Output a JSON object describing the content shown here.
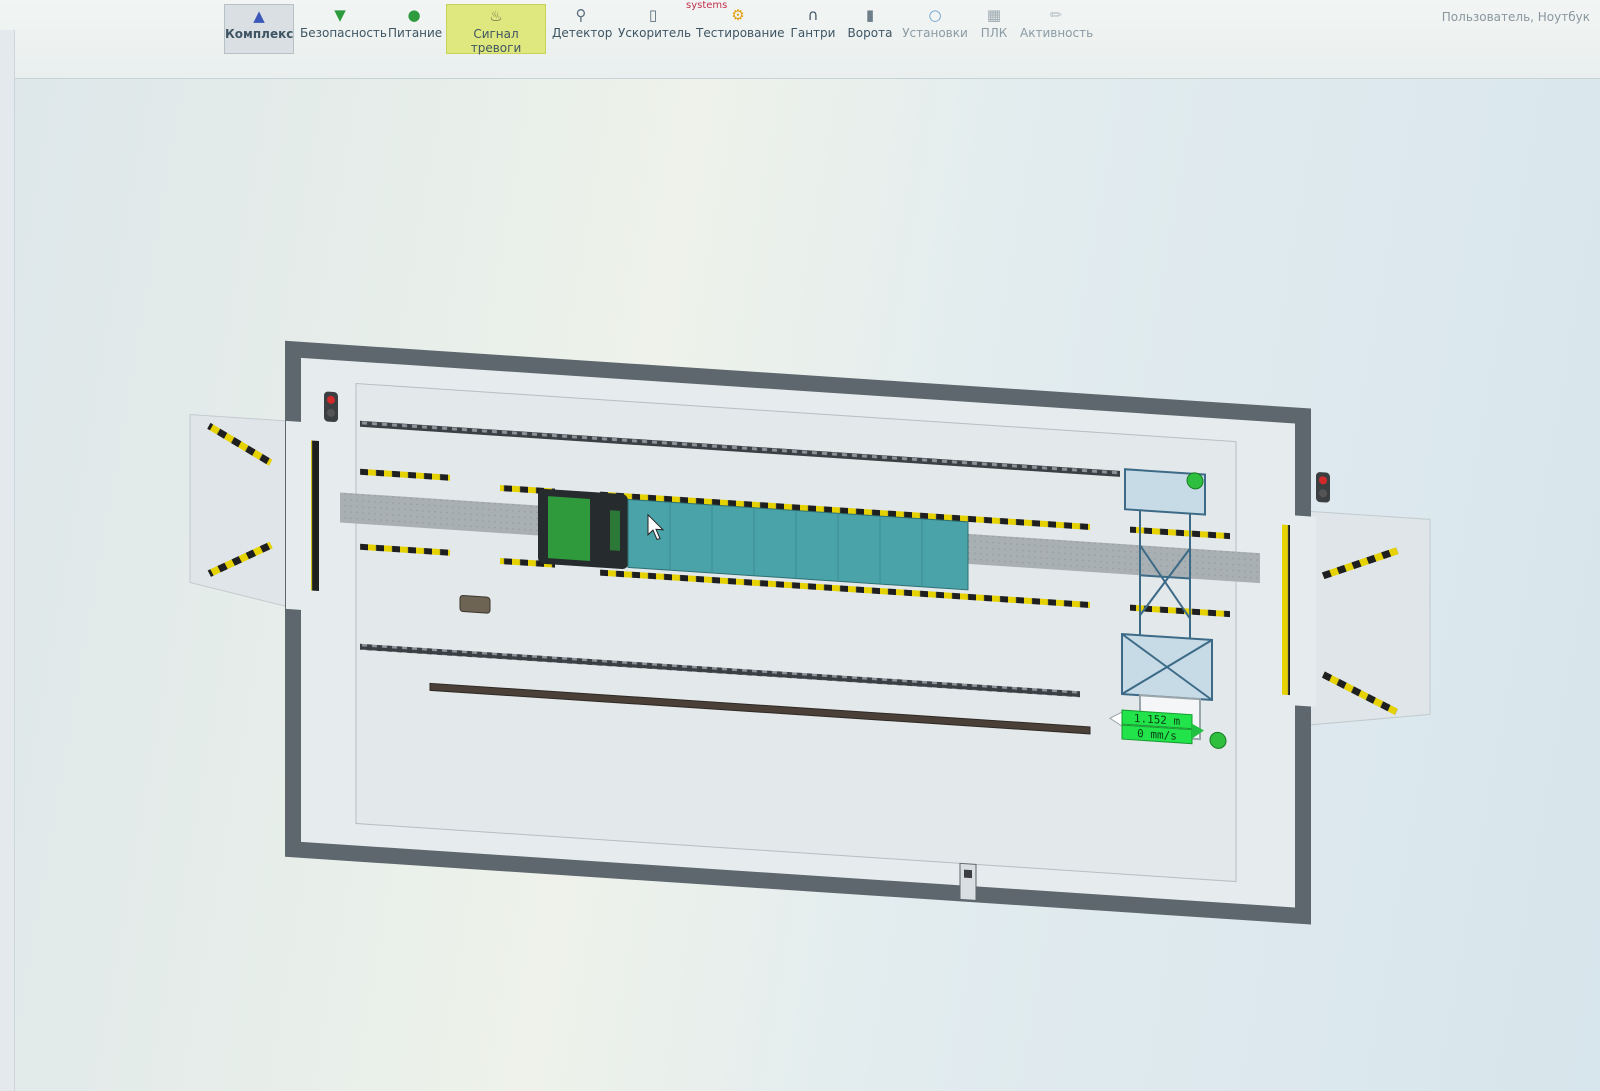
{
  "app": {
    "brand": "systems",
    "user_name": "Пользователь, Ноутбук"
  },
  "toolbar": {
    "items": [
      {
        "key": "complex",
        "label": "Комплекс",
        "icon": "person-icon"
      },
      {
        "key": "safety",
        "label": "Безопасность",
        "icon": "shield-icon"
      },
      {
        "key": "power",
        "label": "Питание",
        "icon": "power-icon"
      },
      {
        "key": "alarm",
        "label": "Сигнал тревоги",
        "icon": "bell-icon"
      },
      {
        "key": "detector",
        "label": "Детектор",
        "icon": "magnifier-icon"
      },
      {
        "key": "accel",
        "label": "Ускоритель",
        "icon": "device-icon"
      },
      {
        "key": "testing",
        "label": "Тестирование",
        "icon": "gear-icon"
      },
      {
        "key": "gantry",
        "label": "Гантри",
        "icon": "gantry-icon"
      },
      {
        "key": "gates",
        "label": "Ворота",
        "icon": "gate-icon"
      },
      {
        "key": "settings",
        "label": "Установки",
        "icon": "settings-icon"
      },
      {
        "key": "plc",
        "label": "ПЛК",
        "icon": "plc-icon"
      },
      {
        "key": "activity",
        "label": "Активность",
        "icon": "pencil-icon"
      }
    ],
    "active": "complex",
    "highlighted": "alarm"
  },
  "gantry_readout": {
    "position": "1.152 m",
    "speed": "0 mm/s"
  },
  "colors": {
    "alarm_highlight": "#dfe77f",
    "truck_cab": "#2f9a3c",
    "trailer": "#4aa3a8",
    "readout_bg": "#22e34a",
    "hazard_yellow": "#e5d200",
    "traffic_red": "#d22a2a"
  }
}
